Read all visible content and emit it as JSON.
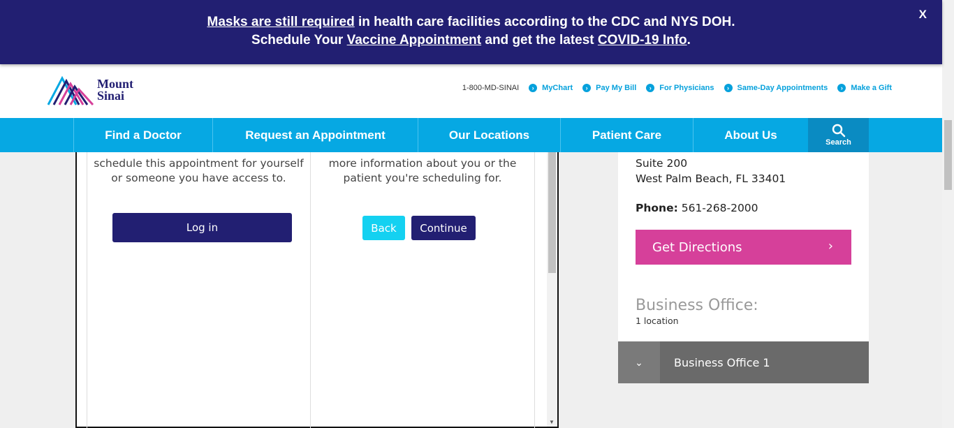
{
  "alert": {
    "line1_link": "Masks are still required",
    "line1_rest": " in health care facilities according to the CDC and NYS DOH.",
    "line2_pre": "Schedule Your ",
    "line2_link1": "Vaccine Appointment",
    "line2_mid": " and get the latest ",
    "line2_link2": "COVID-19 Info",
    "line2_end": ".",
    "close": "X"
  },
  "header": {
    "logo_line1": "Mount",
    "logo_line2": "Sinai",
    "phone": "1-800-MD-SINAI",
    "links": [
      "MyChart",
      "Pay My Bill",
      "For Physicians",
      "Same-Day Appointments",
      "Make a Gift"
    ]
  },
  "nav": {
    "items": [
      "Find a Doctor",
      "Request an Appointment",
      "Our Locations",
      "Patient Care",
      "About Us"
    ],
    "search_label": "Search"
  },
  "modal": {
    "left_text_line1": "schedule this appointment for yourself",
    "left_text_line2": "or someone you have access to.",
    "login_label": "Log in",
    "right_text_line1": "more information about you or the",
    "right_text_line2": "patient you're scheduling for.",
    "back_label": "Back",
    "continue_label": "Continue"
  },
  "side": {
    "address_line1": "Suite 200",
    "address_line2": "West Palm Beach, FL 33401",
    "phone_label": "Phone:",
    "phone_value": " 561-268-2000",
    "directions_label": "Get Directions",
    "business_office_title": "Business Office:",
    "business_office_count": "1 location",
    "accordion_item": "Business Office 1"
  },
  "colors": {
    "navy": "#221f72",
    "cyan": "#06a8e3",
    "magenta": "#d6409a"
  }
}
